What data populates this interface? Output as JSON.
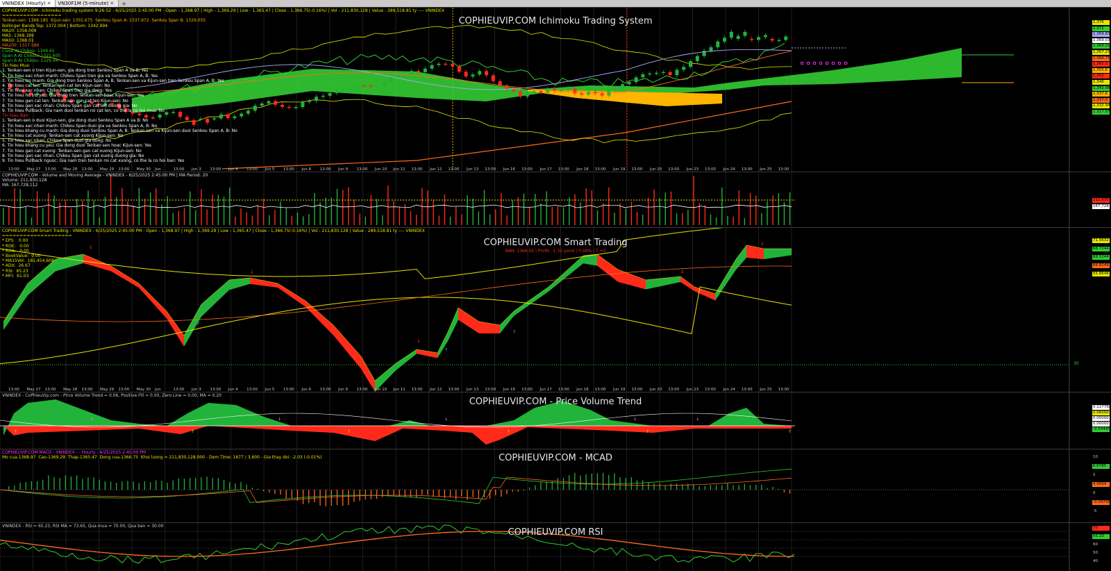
{
  "tabs": [
    {
      "label": "VNINDEX (Hourly)",
      "active": true
    },
    {
      "label": "VN30F1M (5-minute)",
      "active": false
    }
  ],
  "icons": {
    "close": "close-icon",
    "add": "plus-icon"
  },
  "colors": {
    "up": "#22b33a",
    "down": "#ff2a1a",
    "cloud_green": "#33cc33",
    "cloud_orange": "#ffb400",
    "yellow": "#e6e600",
    "orange": "#ff6a1a",
    "magenta": "#ff33ff"
  },
  "panes": {
    "ichimoku": {
      "title": "COPHIEUVIP.COM Ichimoku Trading System",
      "header_lines": [
        {
          "text": "COPHIEUVIP.COM - Ichimoku trading system 9-26-52 - 6/25/2025 2:45:00 PM - Open - 1,368.97 | High - 1,369.29 | Low - 1,365.47 | Close - 1,366.75(-0.16%) | Vol - 211,830,128 | Value - 289,518.81 ty ---- VNINDEX",
          "color": "#e6e600"
        },
        {
          "text": "=================",
          "color": "#e6e600"
        },
        {
          "text": "Tenkan-sen: 1368.185  Kijun-sen: 1355.675  Senkou Span A: 1337.672  Senkou Span B: 1329.055",
          "color": "#ffb400"
        },
        {
          "text": "Bollinger Bands Top: 1372.004 | Bottom: 1342.994",
          "color": "#e6e600"
        },
        {
          "text": "MA20: 1358.009",
          "color": "#e6e600"
        },
        {
          "text": "MA5: 1368.189",
          "color": "#e6e600"
        },
        {
          "text": "MA50: 1368.01",
          "color": "#e6e600"
        },
        {
          "text": "MA200: 1317.586",
          "color": "#ff6a1a"
        },
        {
          "text": "Close At Chikou: 1349.61",
          "color": "#33cc33"
        },
        {
          "text": "Span A At Chikou: 1321.605",
          "color": "#33cc33"
        },
        {
          "text": "Span B At Chikou: 1329.44",
          "color": "#33cc33"
        },
        {
          "text": "Tin hieu Mua:",
          "color": "#e6e600"
        },
        {
          "text": "1. Tenkan-sen o tren Kijun-sen, gia dong tren Senkou Span A va B: Yes",
          "color": "#ffffff"
        },
        {
          "text": "2. Tin hieu xac nhan manh: Chikou Span tren gia va Senkou Span A, B: Yes",
          "color": "#ffffff"
        },
        {
          "text": "3. Tin hieu tro manh: Gia dong tren Senkou Span A, B, Tenkan-sen va Kijun-sen tren Senkou Span A, B: Yes",
          "color": "#ffffff"
        },
        {
          "text": "4. Tin hieu cat len: Tenkan-sen cat len Kijun-sen: No",
          "color": "#ffffff"
        },
        {
          "text": "5. Tin hieu xac nhan: Chikou Span tren gia dong: Yes",
          "color": "#ffffff"
        },
        {
          "text": "6. Tin hieu ho tro yeu: Gia dong tren Tenkan-sen hoac Kijun-sen: Yes",
          "color": "#ffffff"
        },
        {
          "text": "7. Tin hieu gan cat len: Tenkan-sen gan cat len Kijun-sen: No",
          "color": "#ffffff"
        },
        {
          "text": "8. Tin hieu gan xac nhan: Chikou Span gan cat len duong gia: No",
          "color": "#ffffff"
        },
        {
          "text": "9. Tin hieu Pullback: Gia nam duoi tenkan roi cat len, co the la co hoi mua: No",
          "color": "#ffffff"
        },
        {
          "text": "Tin hieu Ban:",
          "color": "#ff2a1a"
        },
        {
          "text": "1. Tenkan-sen o duoi Kijun-sen, gia dong duoi Senkou Span A va B: No",
          "color": "#ffffff"
        },
        {
          "text": "2. Tin hieu xac nhan manh: Chikou Span duoi gia va Senkou Span A, B: No",
          "color": "#ffffff"
        },
        {
          "text": "3. Tin hieu khang cu manh: Gia dong duoi Senkou Span A, B, Tenkan-sen va Kijun-sen duoi Senkou Span A, B: No",
          "color": "#ffffff"
        },
        {
          "text": "4. Tin hieu cat xuong: Tenkan-sen cat xuong Kijun-sen: No",
          "color": "#ffffff"
        },
        {
          "text": "5. Tin hieu xac nhan: Chikou Span duoi gia dong: No",
          "color": "#ffffff"
        },
        {
          "text": "6. Tin hieu khang cu yeu: Gia dong duoi Tenkan-sen hoac Kijun-sen: Yes",
          "color": "#ffffff"
        },
        {
          "text": "7. Tin hieu gan cat xuong: Tenkan-sen gan cat xuong Kijun-sen: No",
          "color": "#ffffff"
        },
        {
          "text": "8. Tin hieu gan xac nhan: Chikou Span gan cat xuong duong gia: No",
          "color": "#ffffff"
        },
        {
          "text": "9. Tin hieu Pullback nguoc: Gia nam tren tenkan roi cat xuong, co the la co hoi ban: Yes",
          "color": "#ffffff"
        }
      ],
      "price_tags": [
        "1,376",
        "1,371",
        "1,369.83",
        "1,369.03",
        "1,368.01",
        "1,367.23",
        "1,366.75",
        "1,365.0",
        "1,355.6",
        "1,352",
        "1,346",
        "1,342.99",
        "1,337.6",
        "1,337.0",
        "1,332.94",
        "1,317.57"
      ]
    },
    "time_axis": [
      "13:00",
      "May 27",
      "13:00",
      "May 28",
      "13:00",
      "May 29",
      "13:00",
      "May 30",
      "Jun",
      "13:00",
      "Jun 3",
      "13:00",
      "Jun 4",
      "13:00",
      "Jun 5",
      "13:00",
      "Jun 6",
      "13:00",
      "Jun 9",
      "13:00",
      "Jun 10",
      "Jun 11",
      "13:00",
      "Jun 12",
      "13:00",
      "Jun 13",
      "13:00",
      "Jun 16",
      "13:00",
      "Jun 17",
      "13:00",
      "Jun 18",
      "13:00",
      "Jun 19",
      "13:00",
      "Jun 20",
      "13:00",
      "Jun 23",
      "13:00",
      "Jun 24",
      "13:00",
      "Jun 25",
      "13:00"
    ],
    "volume": {
      "header_lines": [
        {
          "text": "COPHIEUVIP.COM - Volume and Moving Average - VNINDEX - 6/25/2025 2:45:00 PM | MA Period: 20",
          "color": "#dddddd"
        },
        {
          "text": "Volume: 211,830,128",
          "color": "#dddddd"
        },
        {
          "text": "MA: 167,728,112",
          "color": "#dddddd"
        }
      ],
      "tags": [
        "211,830",
        "167,728"
      ]
    },
    "smart": {
      "title": "COPHIEUVIP.COM Smart Trading",
      "subtitle": "BAN: 1366.02 | Profit: -1.32 point | 0.09% | T +0",
      "header_lines": [
        {
          "text": "COPHIEUVIP.COM Smart Trading - VNINDEX - 6/25/2025 2:45:00 PM - Open - 1,368.97 | High - 1,369.29 | Low - 1,365.47 | Close - 1,366.75(-0.16%) | Vol - 211,830,128 | Value - 289,518.81 ty ---- VNINDEX",
          "color": "#e6e600"
        },
        {
          "text": "====================",
          "color": "#e6e600"
        },
        {
          "text": "* EPS:   0.00",
          "color": "#e6e600"
        },
        {
          "text": "* ROE:   0.00",
          "color": "#e6e600"
        },
        {
          "text": "* ROA:   0.00",
          "color": "#e6e600"
        },
        {
          "text": "* BookValue:  0.00",
          "color": "#e6e600"
        },
        {
          "text": "* MA15Vol:  181,454,608",
          "color": "#e6e600"
        },
        {
          "text": "* ADX:  26.67",
          "color": "#e6e600"
        },
        {
          "text": "* RSI:  65.23",
          "color": "#e6e600"
        },
        {
          "text": "* MFI:  61.03",
          "color": "#e6e600"
        }
      ],
      "tags": [
        "71.5632",
        "68.7244",
        "68.5244",
        "66.8249",
        "55.8648",
        "30"
      ]
    },
    "pvt": {
      "title": "COPHIEUVIP.COM - Price Volume Trend",
      "header": "VNINDEX - CoPhieuVip.com - Price Volume Trend = 0.06, Positive Fill = 0.00, Zero Line = 0.00, MA = 0.20",
      "tags": [
        "0.127768",
        "0.06000",
        "0.00000",
        "0.00000",
        "-0.04440"
      ]
    },
    "macd": {
      "title": "COPHIEUVIP.COM - MCAD",
      "header1": "COPHIEUVIP.COM MACD - VNINDEX - - Hourly - 6/25/2025 2:45:00 PM",
      "header2": "Mo cua-1368.97  Cao-1369.29  Thap-1365.47  Dong cua-1366.75  Khoi luong = 211,830,128.000 - Dem Time: 1677 / 3,600 - Gia thay doi: -2.03 (-0.01%)",
      "tags": [
        "10",
        "6.6785",
        "5",
        "4.9934",
        "0",
        "-0.04745",
        "-5"
      ]
    },
    "rsi": {
      "title": "COPHIEUVIP.COM RSI",
      "header": "VNINDEX - RSI = 65.23, RSI MA = 73.65, Qua mua = 70.00, Qua ban = 30.00",
      "tags": [
        "70",
        "65.23",
        "60",
        "50",
        "40"
      ]
    }
  }
}
